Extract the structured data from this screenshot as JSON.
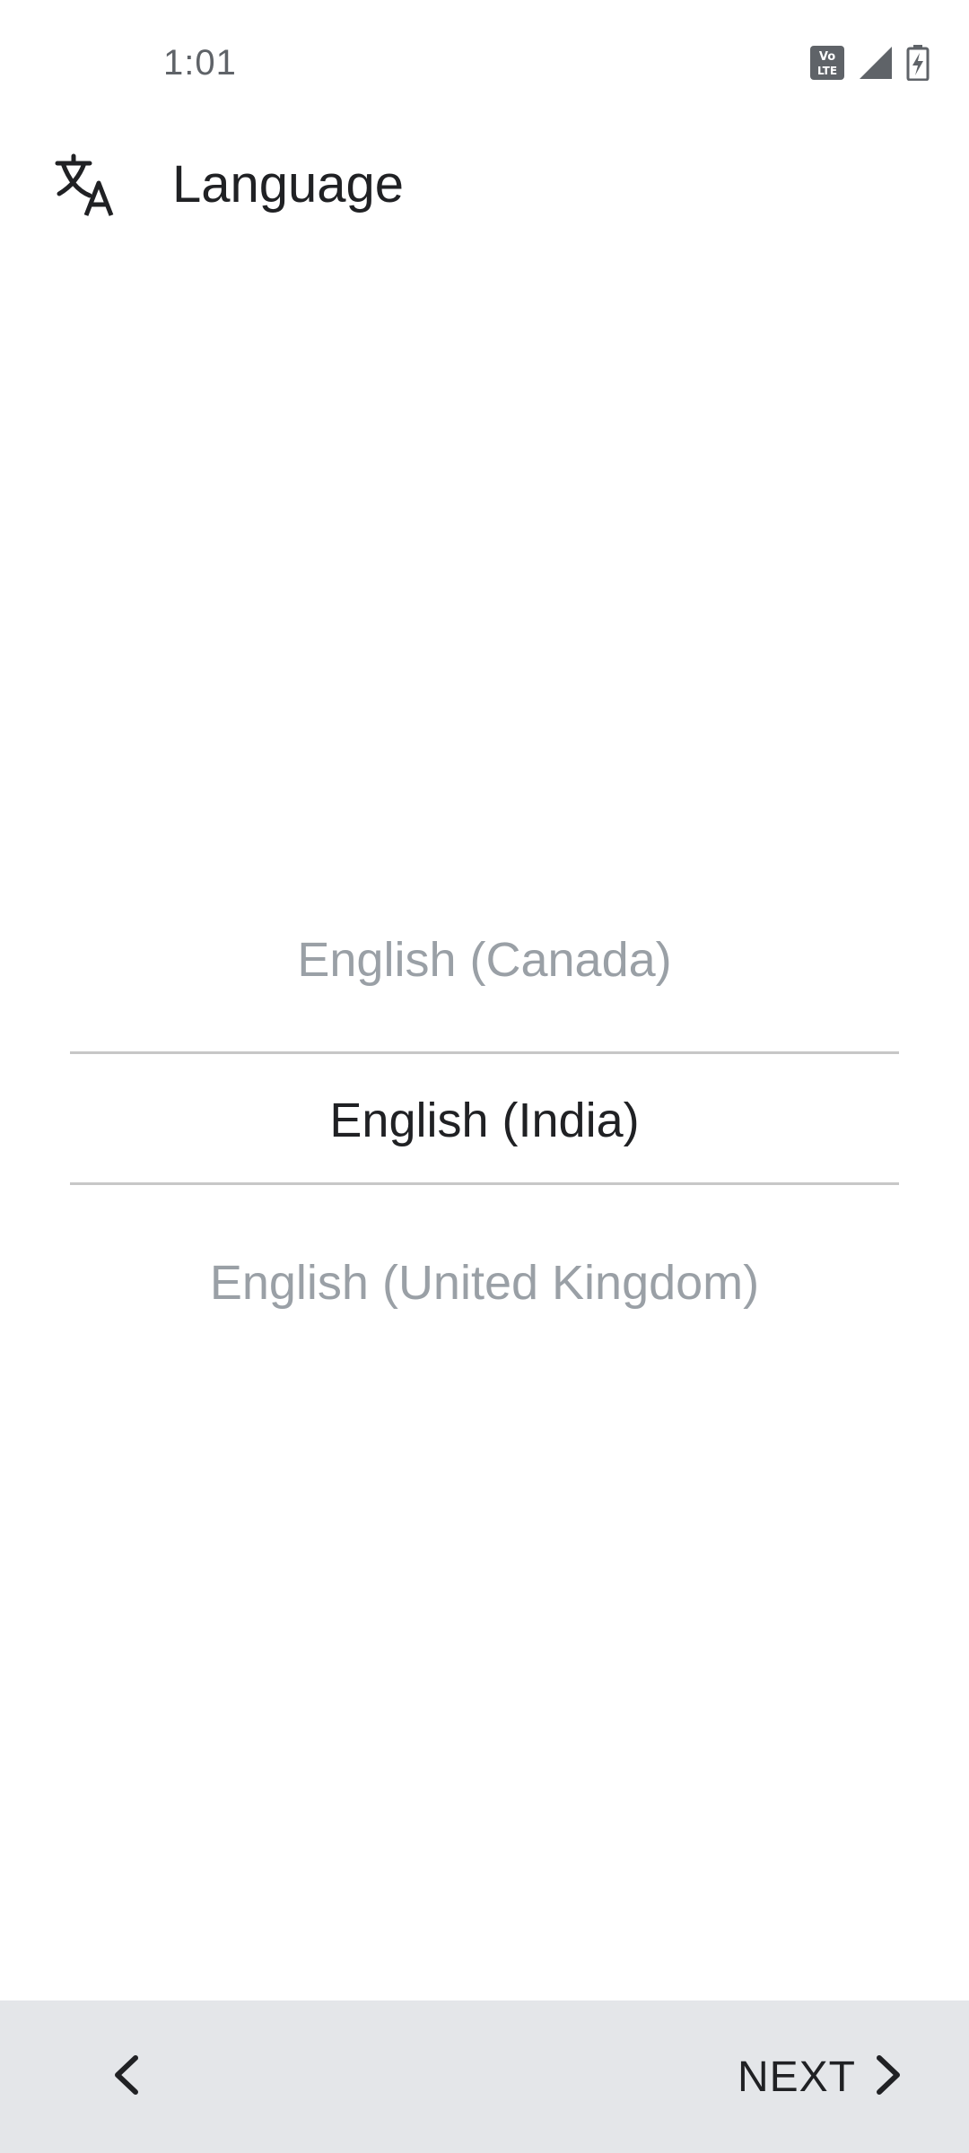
{
  "status_bar": {
    "time": "1:01",
    "icons": [
      "volte-icon",
      "signal-icon",
      "battery-charging-icon"
    ]
  },
  "header": {
    "icon": "translate-icon",
    "title": "Language"
  },
  "picker": {
    "items": [
      "English (Canada)",
      "English (India)",
      "English (United Kingdom)"
    ],
    "selected_index": 1
  },
  "bottom_bar": {
    "back_icon": "chevron-left-icon",
    "next_label": "NEXT",
    "next_icon": "chevron-right-icon"
  },
  "colors": {
    "background": "#ffffff",
    "bottom_bar": "#e4e6e9",
    "text_primary": "#202124",
    "text_dim": "#9aa0a6",
    "divider": "#c7c7c7"
  }
}
